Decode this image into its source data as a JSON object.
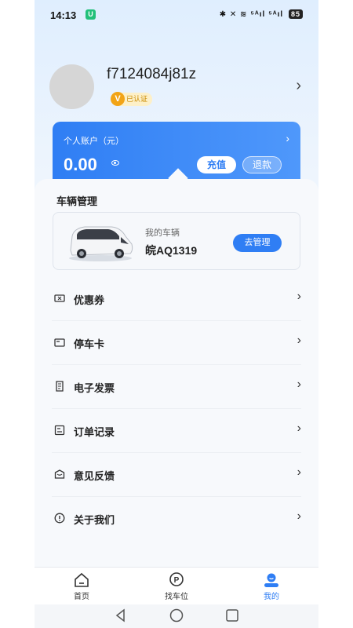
{
  "status_bar": {
    "time": "14:13",
    "app_badge": "U",
    "icons_text": "✱ ✕ ≋ ⁵ᴬıl ⁵ᴬıl",
    "battery": "85"
  },
  "profile": {
    "username": "f7124084j81z",
    "verified_letter": "V",
    "verified_label": "已认证"
  },
  "account": {
    "title": "个人账户（元）",
    "balance": "0.00",
    "recharge_label": "充值",
    "refund_label": "退款"
  },
  "vehicle": {
    "section_title": "车辆管理",
    "label": "我的车辆",
    "plate": "皖AQ1319",
    "manage_label": "去管理"
  },
  "menu": [
    {
      "label": "优惠券",
      "icon": "coupon-icon"
    },
    {
      "label": "停车卡",
      "icon": "card-icon"
    },
    {
      "label": "电子发票",
      "icon": "invoice-icon"
    },
    {
      "label": "订单记录",
      "icon": "order-icon"
    },
    {
      "label": "意见反馈",
      "icon": "feedback-icon"
    },
    {
      "label": "关于我们",
      "icon": "info-icon"
    }
  ],
  "tabbar": [
    {
      "label": "首页",
      "icon": "home-icon",
      "active": false
    },
    {
      "label": "找车位",
      "icon": "parking-icon",
      "active": false
    },
    {
      "label": "我的",
      "icon": "user-icon",
      "active": true
    }
  ],
  "colors": {
    "accent": "#2f7ef4",
    "verified": "#f2a417"
  }
}
